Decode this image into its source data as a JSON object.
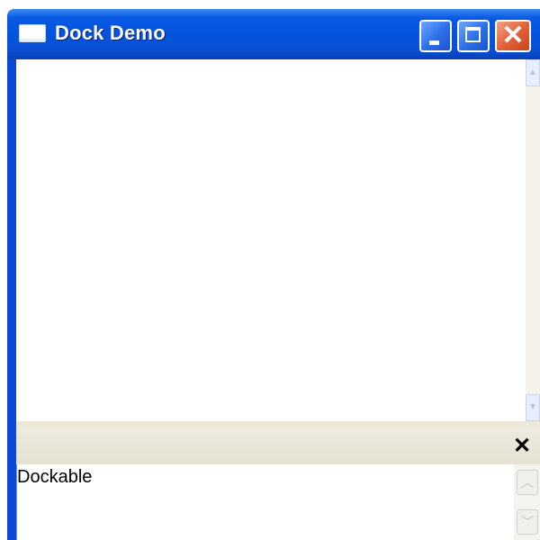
{
  "window": {
    "title": "Dock Demo",
    "icons": {
      "app": "window-icon",
      "minimize": "minimize-icon",
      "maximize": "maximize-icon",
      "close": "close-icon"
    },
    "colors": {
      "titlebar": "#0454de",
      "close_button": "#e3633b",
      "frame": "#0a49d9"
    }
  },
  "dock": {
    "close_icon": "close-x-icon",
    "content_text": "Dockable",
    "scroll_up_icon": "chevron-up-icon",
    "scroll_down_icon": "chevron-down-icon"
  }
}
